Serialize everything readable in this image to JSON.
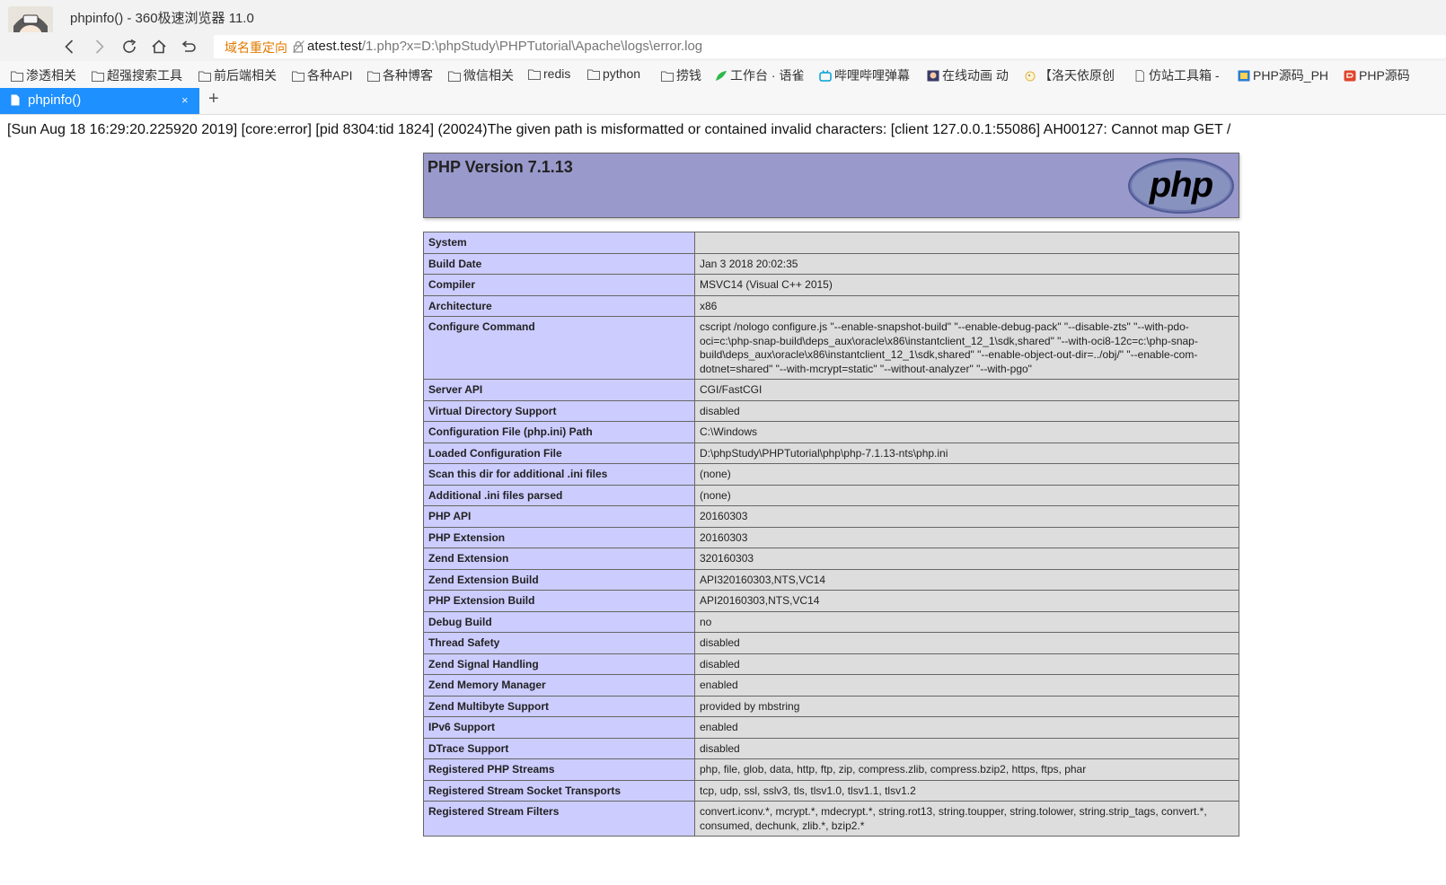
{
  "window": {
    "title": "phpinfo() - 360极速浏览器 11.0",
    "avatar_icon": "user-avatar-icon"
  },
  "toolbar": {
    "back_icon": "chevron-left-icon",
    "forward_icon": "chevron-right-icon",
    "reload_icon": "refresh-icon",
    "home_icon": "home-icon",
    "undo_icon": "undo-icon",
    "redirect_label": "域名重定向",
    "url_host": "atest.test",
    "url_path": "/1.php?x=D:\\phpStudy\\PHPTutorial\\Apache\\logs\\error.log"
  },
  "bookmarks": [
    {
      "label": "渗透相关",
      "icon": "folder-icon"
    },
    {
      "label": "超强搜索工具",
      "icon": "folder-icon"
    },
    {
      "label": "前后端相关",
      "icon": "folder-icon"
    },
    {
      "label": "各种API",
      "icon": "folder-icon"
    },
    {
      "label": "各种博客",
      "icon": "folder-icon"
    },
    {
      "label": "微信相关",
      "icon": "folder-icon"
    },
    {
      "label": "redis",
      "icon": "folder-icon"
    },
    {
      "label": "python",
      "icon": "folder-icon"
    },
    {
      "label": "捞钱",
      "icon": "folder-icon"
    },
    {
      "label": "工作台 · 语雀",
      "icon": "yuque-icon"
    },
    {
      "label": "哔哩哔哩弹幕",
      "icon": "bilibili-icon"
    },
    {
      "label": "在线动画 动",
      "icon": "anime-site-icon"
    },
    {
      "label": "【洛天依原创",
      "icon": "chicken-icon"
    },
    {
      "label": "仿站工具箱 -",
      "icon": "page-icon"
    },
    {
      "label": "PHP源码_PH",
      "icon": "php-source-icon"
    },
    {
      "label": "PHP源码",
      "icon": "php-red-icon"
    }
  ],
  "tabs": {
    "active_title": "phpinfo()",
    "close_symbol": "×",
    "new_tab_symbol": "+"
  },
  "page": {
    "error_line": "[Sun Aug 18 16:29:20.225920 2019] [core:error] [pid 8304:tid 1824] (20024)The given path is misformatted or contained invalid characters: [client 127.0.0.1:55086] AH00127: Cannot map GET /",
    "php_version": "PHP Version 7.1.13",
    "logo_text": "php",
    "rows": [
      {
        "key": "System",
        "value": ""
      },
      {
        "key": "Build Date",
        "value": "Jan 3 2018 20:02:35"
      },
      {
        "key": "Compiler",
        "value": "MSVC14 (Visual C++ 2015)"
      },
      {
        "key": "Architecture",
        "value": "x86"
      },
      {
        "key": "Configure Command",
        "value": "cscript /nologo configure.js \"--enable-snapshot-build\" \"--enable-debug-pack\" \"--disable-zts\" \"--with-pdo-oci=c:\\php-snap-build\\deps_aux\\oracle\\x86\\instantclient_12_1\\sdk,shared\" \"--with-oci8-12c=c:\\php-snap-build\\deps_aux\\oracle\\x86\\instantclient_12_1\\sdk,shared\" \"--enable-object-out-dir=../obj/\" \"--enable-com-dotnet=shared\" \"--with-mcrypt=static\" \"--without-analyzer\" \"--with-pgo\""
      },
      {
        "key": "Server API",
        "value": "CGI/FastCGI"
      },
      {
        "key": "Virtual Directory Support",
        "value": "disabled"
      },
      {
        "key": "Configuration File (php.ini) Path",
        "value": "C:\\Windows"
      },
      {
        "key": "Loaded Configuration File",
        "value": "D:\\phpStudy\\PHPTutorial\\php\\php-7.1.13-nts\\php.ini"
      },
      {
        "key": "Scan this dir for additional .ini files",
        "value": "(none)"
      },
      {
        "key": "Additional .ini files parsed",
        "value": "(none)"
      },
      {
        "key": "PHP API",
        "value": "20160303"
      },
      {
        "key": "PHP Extension",
        "value": "20160303"
      },
      {
        "key": "Zend Extension",
        "value": "320160303"
      },
      {
        "key": "Zend Extension Build",
        "value": "API320160303,NTS,VC14"
      },
      {
        "key": "PHP Extension Build",
        "value": "API20160303,NTS,VC14"
      },
      {
        "key": "Debug Build",
        "value": "no"
      },
      {
        "key": "Thread Safety",
        "value": "disabled"
      },
      {
        "key": "Zend Signal Handling",
        "value": "disabled"
      },
      {
        "key": "Zend Memory Manager",
        "value": "enabled"
      },
      {
        "key": "Zend Multibyte Support",
        "value": "provided by mbstring"
      },
      {
        "key": "IPv6 Support",
        "value": "enabled"
      },
      {
        "key": "DTrace Support",
        "value": "disabled"
      },
      {
        "key": "Registered PHP Streams",
        "value": "php, file, glob, data, http, ftp, zip, compress.zlib, compress.bzip2, https, ftps, phar"
      },
      {
        "key": "Registered Stream Socket Transports",
        "value": "tcp, udp, ssl, sslv3, tls, tlsv1.0, tlsv1.1, tlsv1.2"
      },
      {
        "key": "Registered Stream Filters",
        "value": "convert.iconv.*, mcrypt.*, mdecrypt.*, string.rot13, string.toupper, string.tolower, string.strip_tags, convert.*, consumed, dechunk, zlib.*, bzip2.*"
      }
    ]
  },
  "colors": {
    "tab_active": "#1e90ff",
    "php_header_bg": "#9999cc",
    "key_cell_bg": "#ccccff",
    "value_cell_bg": "#dddddd",
    "redirect_label": "#e07a00"
  }
}
